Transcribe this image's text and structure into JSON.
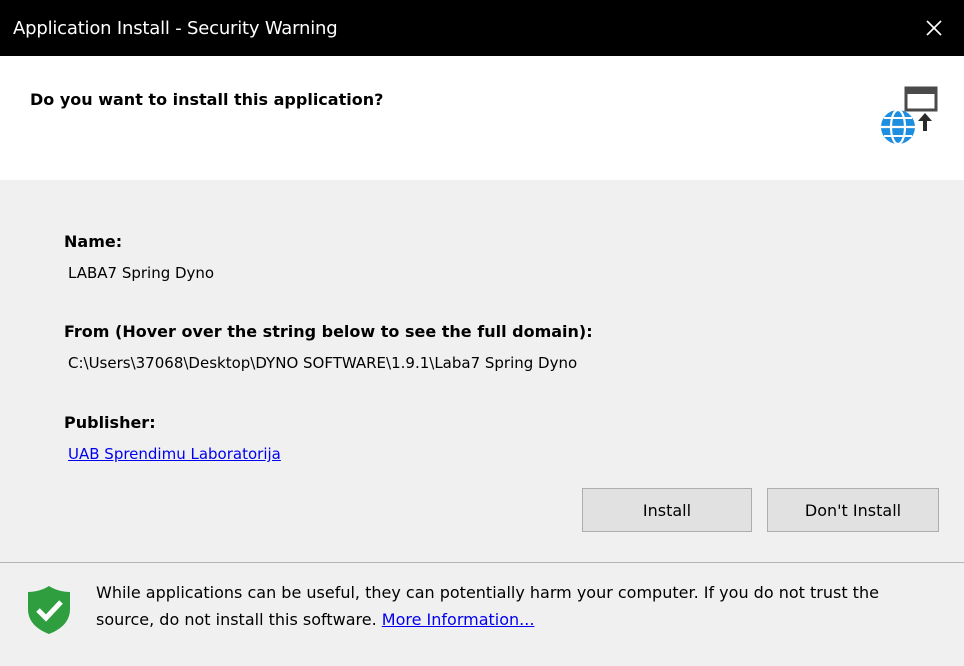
{
  "titlebar": {
    "title": "Application Install - Security Warning",
    "close_icon": "close-icon"
  },
  "header": {
    "question": "Do you want to install this application?",
    "icon": "web-app-install-icon"
  },
  "details": {
    "name_label": "Name:",
    "name_value": "LABA7 Spring Dyno",
    "from_label": "From (Hover over the string below to see the full domain):",
    "from_value": "C:\\Users\\37068\\Desktop\\DYNO SOFTWARE\\1.9.1\\Laba7 Spring Dyno",
    "publisher_label": "Publisher:",
    "publisher_value": "UAB Sprendimu Laboratorija"
  },
  "buttons": {
    "install": "Install",
    "dont_install": "Don't Install"
  },
  "footer": {
    "shield_icon": "shield-check-icon",
    "warning_text": "While applications can be useful, they can potentially harm your computer. If you do not trust the source, do not install this software.",
    "more_info_link": "More Information..."
  },
  "colors": {
    "titlebar": "#000000",
    "link": "#0000ee",
    "shield": "#2e9e3e",
    "globe": "#1e8fe0"
  }
}
